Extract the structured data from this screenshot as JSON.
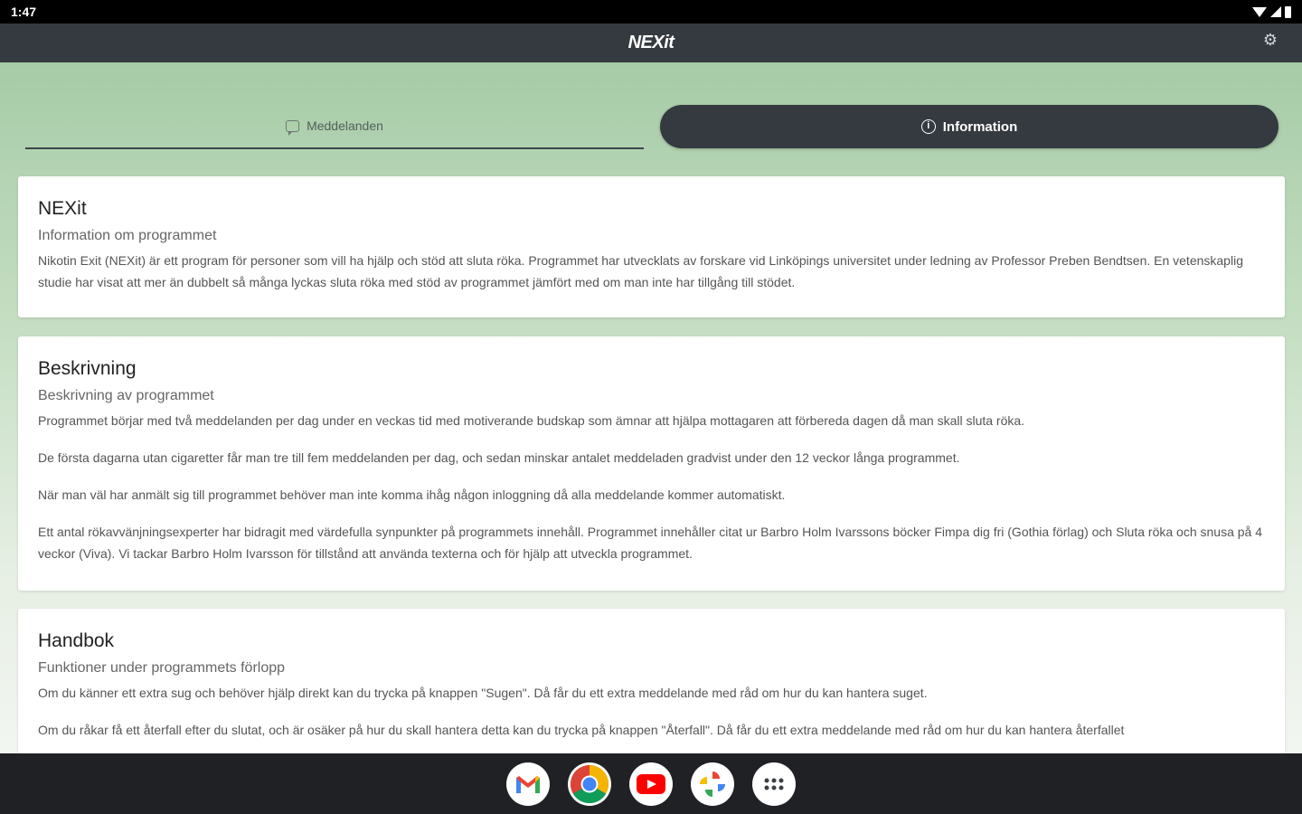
{
  "status_bar": {
    "time": "1:47"
  },
  "app_bar": {
    "title": "NEXit"
  },
  "tabs": [
    {
      "label": "Meddelanden",
      "icon": "chat-icon",
      "selected": false
    },
    {
      "label": "Information",
      "icon": "info-icon",
      "selected": true
    }
  ],
  "cards": {
    "nexit": {
      "title": "NEXit",
      "subtitle": "Information om programmet",
      "paragraphs": [
        "Nikotin Exit (NEXit) är ett program för personer som vill ha hjälp och stöd att sluta röka. Programmet har utvecklats av forskare vid Linköpings universitet under ledning av Professor Preben Bendtsen. En vetenskaplig studie har visat att mer än dubbelt så många lyckas sluta röka med stöd av programmet jämfört med om man inte har tillgång till stödet."
      ]
    },
    "beskrivning": {
      "title": "Beskrivning",
      "subtitle": "Beskrivning av programmet",
      "paragraphs": [
        "Programmet börjar med två meddelanden per dag under en veckas tid med motiverande budskap som ämnar att hjälpa mottagaren att förbereda dagen då man skall sluta röka.",
        "De första dagarna utan cigaretter får man tre till fem meddelanden per dag, och sedan minskar antalet meddeladen gradvist under den 12 veckor långa programmet.",
        "När man väl har anmält sig till programmet behöver man inte komma ihåg någon inloggning då alla meddelande kommer automatiskt.",
        "Ett antal rökavvänjningsexperter har bidragit med värdefulla synpunkter på programmets innehåll. Programmet innehåller citat ur Barbro Holm Ivarssons böcker Fimpa dig fri (Gothia förlag) och Sluta röka och snusa på 4 veckor (Viva). Vi tackar Barbro Holm Ivarsson för tillstånd att använda texterna och för hjälp att utveckla programmet."
      ]
    },
    "handbok": {
      "title": "Handbok",
      "subtitle": "Funktioner under programmets förlopp",
      "paragraphs": [
        "Om du känner ett extra sug och behöver hjälp direkt kan du trycka på knappen \"Sugen\". Då får du ett extra meddelande med råd om hur du kan hantera suget.",
        "Om du råkar få ett återfall efter du slutat, och är osäker på hur du skall hantera detta kan du trycka på knappen \"Återfall\". Då får du ett extra meddelande med råd om hur du kan hantera återfallet"
      ]
    }
  },
  "taskbar": {
    "apps": [
      {
        "name": "Gmail",
        "icon": "gmail-icon"
      },
      {
        "name": "Chrome",
        "icon": "chrome-icon"
      },
      {
        "name": "YouTube",
        "icon": "youtube-icon"
      },
      {
        "name": "Photos",
        "icon": "photos-icon"
      },
      {
        "name": "App launcher",
        "icon": "app-launcher-icon"
      }
    ]
  },
  "colors": {
    "app_bar": "#343a40",
    "background_top": "#a6cba6",
    "background_bottom": "#f2f6f1",
    "card": "#ffffff",
    "taskbar": "#202124"
  }
}
